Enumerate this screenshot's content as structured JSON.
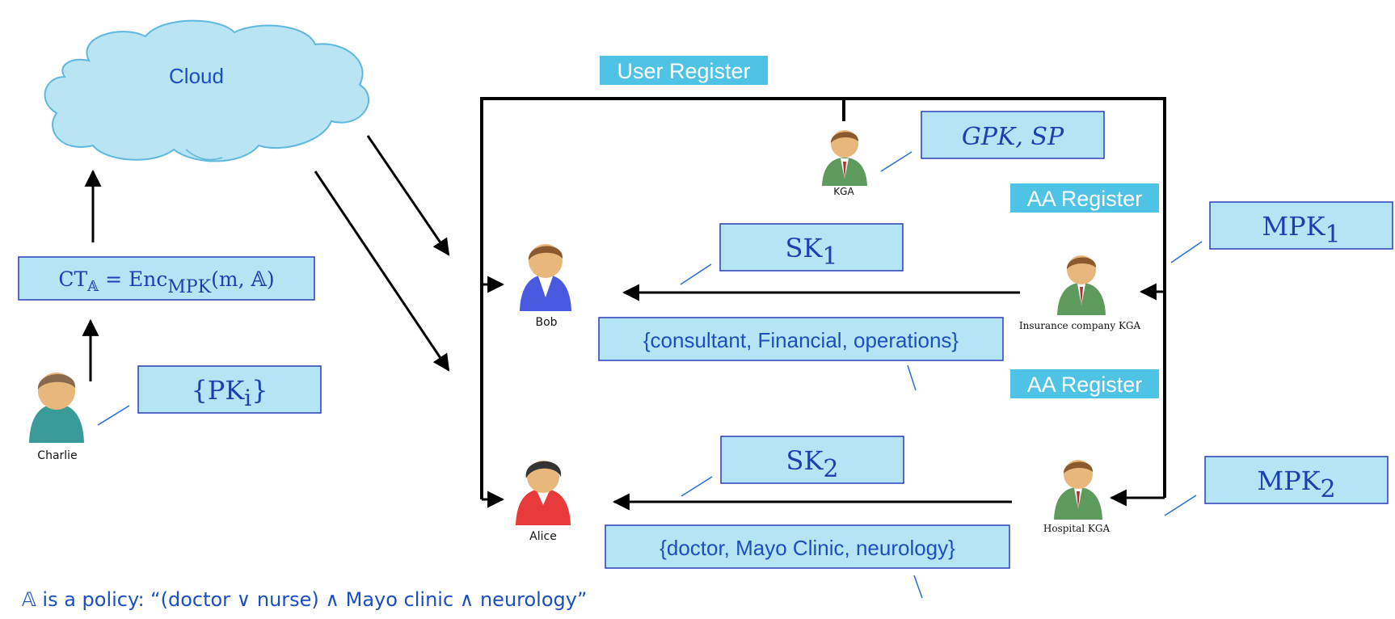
{
  "cloud": {
    "label": "Cloud"
  },
  "headers": {
    "user_register": "User Register",
    "aa_register_1": "AA Register",
    "aa_register_2": "AA Register"
  },
  "actors": {
    "kga": "KGA",
    "bob": "Bob",
    "alice": "Alice",
    "charlie": "Charlie",
    "insurance_kga": "Insurance company KGA",
    "hospital_kga": "Hospital KGA"
  },
  "boxes": {
    "gpk_sp": "GPK, SP",
    "sk1": {
      "main": "SK",
      "sub": "1"
    },
    "sk2": {
      "main": "SK",
      "sub": "2"
    },
    "mpk1": {
      "main": "MPK",
      "sub": "1"
    },
    "mpk2": {
      "main": "MPK",
      "sub": "2"
    },
    "pk": {
      "main": "{PK",
      "sub": "i",
      "tail": "}"
    },
    "ct": {
      "main": "CT",
      "sub1": "𝔸",
      "eq": " = Enc",
      "sub2": "MPK",
      "tail": "(m, 𝔸)"
    },
    "bob_attrs": "{consultant, Financial, operations}",
    "alice_attrs": "{doctor, Mayo Clinic, neurology}"
  },
  "policy_note": "𝔸 is a policy: “(doctor ∨ nurse) ∧ Mayo clinic ∧ neurology”",
  "colors": {
    "box_fill": "#b5e4f4",
    "box_stroke": "#2a3fb8",
    "header_fill": "#4ec3e6",
    "text_blue": "#1a4fc0"
  }
}
